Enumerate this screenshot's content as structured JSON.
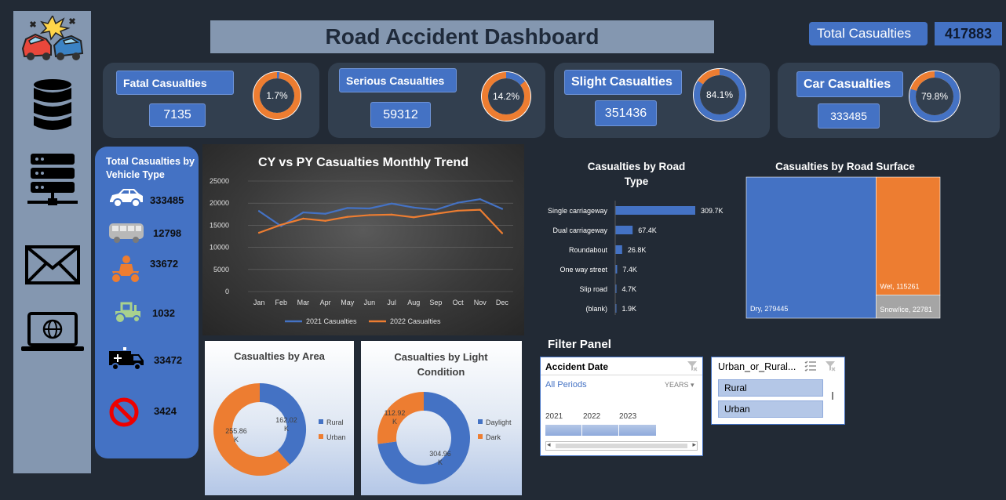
{
  "title": "Road Accident Dashboard",
  "total": {
    "label": "Total Casualties",
    "value": "417883"
  },
  "kpis": [
    {
      "label": "Fatal Casualties",
      "value": "7135",
      "pct_label": "1.7%",
      "pct": 1.7
    },
    {
      "label": "Serious Casualties",
      "value": "59312",
      "pct_label": "14.2%",
      "pct": 14.2
    },
    {
      "label": "Slight Casualties",
      "value": "351436",
      "pct_label": "84.1%",
      "pct": 84.1
    },
    {
      "label": "Car Casualties",
      "value": "333485",
      "pct_label": "79.8%",
      "pct": 79.8
    }
  ],
  "vehicle": {
    "title": "Total Casualties by Vehicle Type",
    "items": [
      {
        "icon": "car-icon",
        "value": "333485"
      },
      {
        "icon": "bus-icon",
        "value": "12798"
      },
      {
        "icon": "motorcycle-icon",
        "value": "33672"
      },
      {
        "icon": "tractor-icon",
        "value": "1032"
      },
      {
        "icon": "van-icon",
        "value": "33472"
      },
      {
        "icon": "no-entry-icon",
        "value": "3424"
      }
    ]
  },
  "filter": {
    "title": "Filter Panel",
    "date": {
      "header": "Accident Date",
      "period": "All Periods",
      "unit": "YEARS",
      "years": [
        "2021",
        "2022",
        "2023"
      ]
    },
    "area": {
      "header": "Urban_or_Rural...",
      "options": [
        "Rural",
        "Urban"
      ]
    }
  },
  "colors": {
    "blue": "#4472c4",
    "orange": "#ed7d31",
    "grey": "#a5a5a5"
  },
  "chart_data": [
    {
      "type": "line",
      "title": "CY vs PY Casualties Monthly Trend",
      "x": [
        "Jan",
        "Feb",
        "Mar",
        "Apr",
        "May",
        "Jun",
        "Jul",
        "Aug",
        "Sep",
        "Oct",
        "Nov",
        "Dec"
      ],
      "ylim": [
        0,
        25000
      ],
      "yticks": [
        "25000",
        "20000",
        "15000",
        "10000",
        "5000",
        "0"
      ],
      "yticks_values": [
        25000,
        20000,
        15000,
        10000,
        5000,
        0
      ],
      "grid": true,
      "legend": "bottom",
      "series": [
        {
          "name": "2021 Casualties",
          "color": "#4472c4",
          "values": [
            18200,
            14800,
            17900,
            17600,
            18900,
            18800,
            19900,
            19000,
            18500,
            20100,
            20900,
            18700
          ]
        },
        {
          "name": "2022 Casualties",
          "color": "#ed7d31",
          "values": [
            13300,
            15100,
            16500,
            16000,
            16900,
            17300,
            17400,
            16800,
            17600,
            18300,
            18500,
            13200
          ]
        }
      ]
    },
    {
      "type": "bar",
      "orientation": "horizontal",
      "title": "Casualties by Road Type",
      "categories": [
        "Single carriageway",
        "Dual carriageway",
        "Roundabout",
        "One way street",
        "Slip road",
        "(blank)"
      ],
      "values": [
        309.7,
        67.4,
        26.8,
        7.4,
        4.7,
        1.9
      ],
      "labels": [
        "309.7K",
        "67.4K",
        "26.8K",
        "7.4K",
        "4.7K",
        "1.9K"
      ],
      "unit": "K"
    },
    {
      "type": "treemap",
      "title": "Casualties by Road Surface",
      "items": [
        {
          "name": "Dry",
          "value": 279445,
          "label": "Dry, 279445",
          "color": "#4472c4"
        },
        {
          "name": "Wet",
          "value": 115261,
          "label": "Wet, 115261",
          "color": "#ed7d31"
        },
        {
          "name": "Snow/ice",
          "value": 22781,
          "label": "Snow/ice, 22781",
          "color": "#a5a5a5"
        }
      ]
    },
    {
      "type": "pie",
      "title": "Casualties by Area",
      "legend": "right",
      "slices": [
        {
          "name": "Rural",
          "value": 162.02,
          "label": "162.02 K",
          "color": "#4472c4"
        },
        {
          "name": "Urban",
          "value": 255.86,
          "label": "255.86 K",
          "color": "#ed7d31"
        }
      ]
    },
    {
      "type": "pie",
      "title": "Casualties by Light Condition",
      "legend": "right",
      "slices": [
        {
          "name": "Daylight",
          "value": 304.96,
          "label": "304.96 K",
          "color": "#4472c4"
        },
        {
          "name": "Dark",
          "value": 112.92,
          "label": "112.92 K",
          "color": "#ed7d31"
        }
      ]
    }
  ]
}
